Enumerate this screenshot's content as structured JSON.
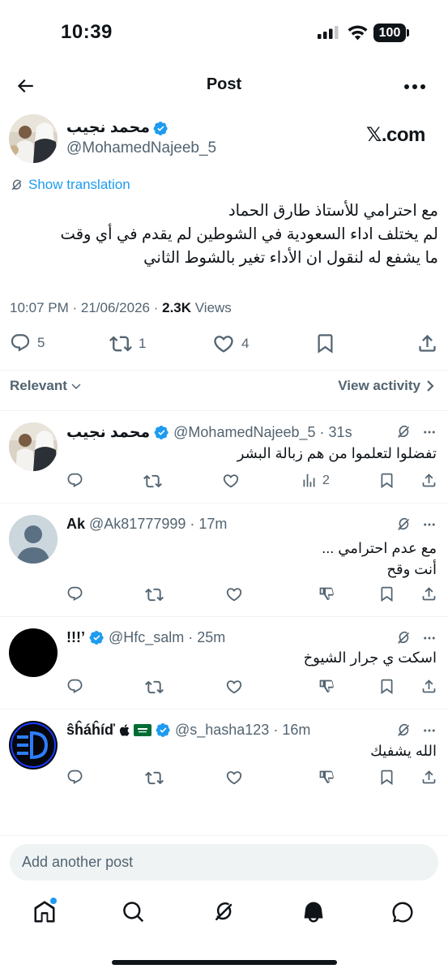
{
  "status_bar": {
    "time": "10:39",
    "battery": "100"
  },
  "header": {
    "title": "Post"
  },
  "post": {
    "author_name": "محمد نجيب",
    "author_handle": "@MohamedNajeeb_5",
    "source_label": "𝕏.com",
    "translate_label": "Show translation",
    "text_lines": [
      "مع احترامي للأستاذ طارق الحماد",
      "لم يختلف اداء السعودية في الشوطين لم يقدم في أي وقت",
      "ما يشفع له لنقول ان الأداء تغير بالشوط الثاني"
    ],
    "time": "10:07 PM",
    "date": "21/06/2026",
    "views_count": "2.3K",
    "views_label": "Views",
    "stats": {
      "replies": "5",
      "reposts": "1",
      "likes": "4"
    }
  },
  "sort": {
    "label": "Relevant",
    "view_activity": "View activity"
  },
  "replies": [
    {
      "name": "محمد نجيب",
      "verified": true,
      "handle": "@MohamedNajeeb_5",
      "age": "31s",
      "text": "تفضلوا لتعلموا من هم زبالة البشر",
      "views": "2"
    },
    {
      "name": "Ak",
      "verified": false,
      "handle": "@Ak81777999",
      "age": "17m",
      "text_lines": [
        "مع عدم احترامي ...",
        "أنت وقح"
      ]
    },
    {
      "name": "!!!’",
      "verified": true,
      "handle": "@Hfc_salm",
      "age": "25m",
      "text": "اسكت ي جرار الشيوخ"
    },
    {
      "name": "ŝĥáĥíď",
      "verified": true,
      "handle": "@s_hasha123",
      "age": "16m",
      "text": "الله يشفيك"
    }
  ],
  "composer": {
    "placeholder": "Add another post"
  },
  "icons": {
    "back": "arrow-left-icon",
    "more": "more-horizontal-icon",
    "verified": "verified-badge-icon",
    "grok": "grok-icon",
    "reply": "reply-icon",
    "repost": "repost-icon",
    "like": "heart-icon",
    "bookmark": "bookmark-icon",
    "share": "share-icon",
    "views": "views-bar-icon",
    "dislike": "downvote-icon",
    "nav": [
      "home-icon",
      "search-icon",
      "grok-icon",
      "notifications-bell-icon",
      "messages-icon"
    ]
  },
  "colors": {
    "accent": "#1d9bf0",
    "text": "#0f1419",
    "secondary": "#536471",
    "divider": "#eff3f4"
  }
}
